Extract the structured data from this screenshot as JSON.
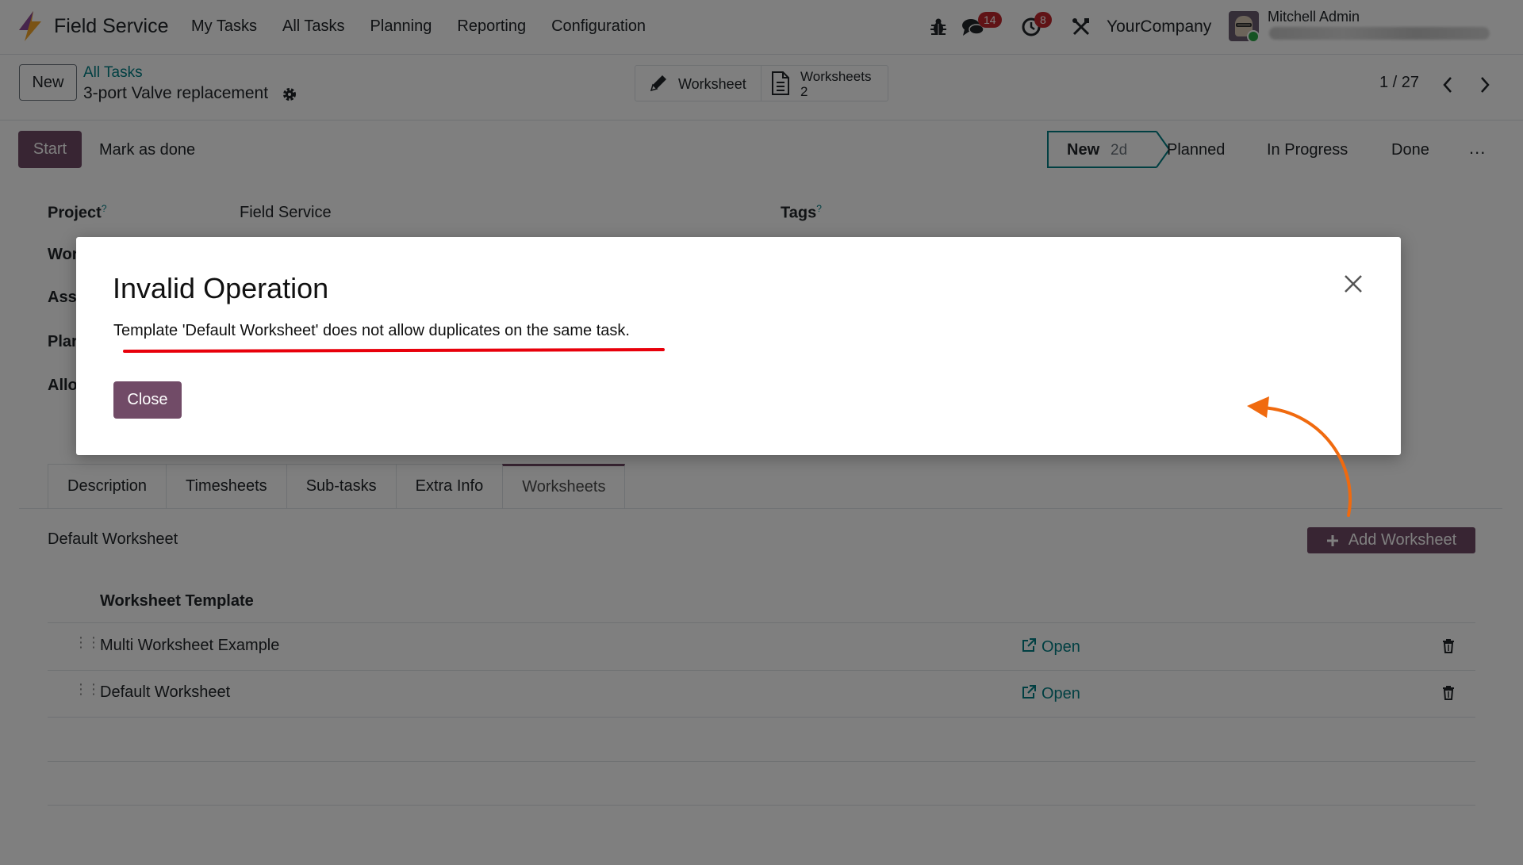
{
  "navbar": {
    "app_name": "Field Service",
    "menu": [
      "My Tasks",
      "All Tasks",
      "Planning",
      "Reporting",
      "Configuration"
    ],
    "icons": {
      "debug": "bug-icon",
      "messages": "chat-icon",
      "activities": "clock-icon",
      "settings": "tools-icon"
    },
    "messages_count": "14",
    "activities_count": "8",
    "company": "YourCompany",
    "user": "Mitchell Admin"
  },
  "control": {
    "new_label": "New",
    "breadcrumb": "All Tasks",
    "record_title": "3-port Valve replacement",
    "smart_worksheet": "Worksheet",
    "smart_worksheets": "Worksheets",
    "smart_worksheets_count": "2",
    "pager": "1 / 27"
  },
  "statusbar": {
    "start_label": "Start",
    "mark_done_label": "Mark as done",
    "stages": [
      "New",
      "Planned",
      "In Progress",
      "Done"
    ],
    "active_stage_duration": "2d",
    "more_label": "..."
  },
  "form": {
    "project_label": "Project",
    "project_value": "Field Service",
    "tags_label": "Tags",
    "help_mark": "?",
    "partial_labels": [
      "Wor",
      "Ass",
      "Plar",
      "Allo"
    ],
    "tabs": [
      "Description",
      "Timesheets",
      "Sub-tasks",
      "Extra Info",
      "Worksheets"
    ],
    "active_tab": "Worksheets",
    "section_title": "Default Worksheet",
    "add_worksheet_label": "Add Worksheet",
    "column_header": "Worksheet Template",
    "rows": [
      {
        "name": "Multi Worksheet Example",
        "action": "Open"
      },
      {
        "name": "Default Worksheet",
        "action": "Open"
      }
    ]
  },
  "dialog": {
    "title": "Invalid Operation",
    "message": "Template 'Default Worksheet' does not allow duplicates on the same task.",
    "close_label": "Close"
  },
  "colors": {
    "brand": "#714b67",
    "link": "#017e84",
    "badge": "#c0272d",
    "underline_annotation": "#e8000b",
    "arrow_annotation": "#f06a0f"
  }
}
